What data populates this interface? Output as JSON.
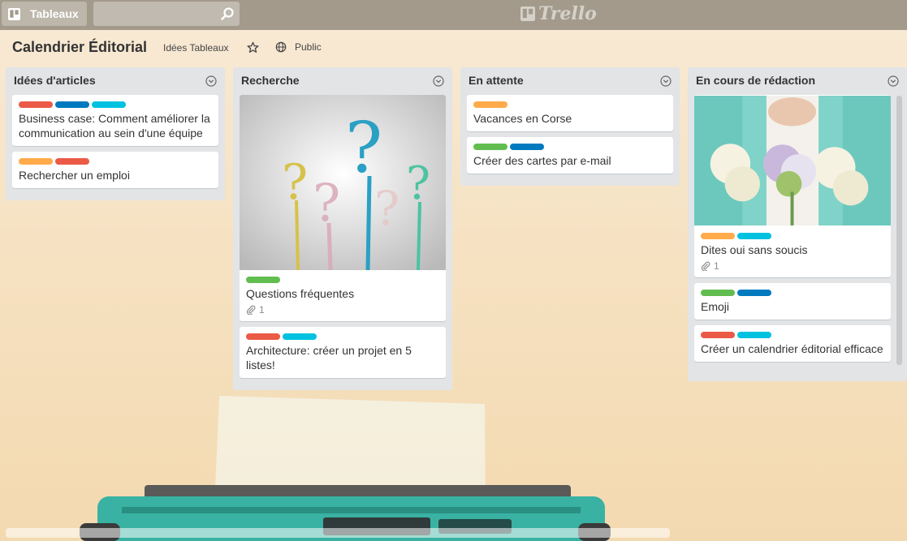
{
  "header": {
    "boards_label": "Tableaux",
    "search_placeholder": "",
    "logo_text": "Trello",
    "brand_color": "#a39a8b"
  },
  "board": {
    "title": "Calendrier Éditorial",
    "team": "Idées Tableaux",
    "visibility": "Public"
  },
  "label_colors": {
    "red": "#eb5a46",
    "blue": "#0079bf",
    "sky": "#00c2e0",
    "orange": "#ffab4a",
    "green": "#61bd4f"
  },
  "lists": [
    {
      "title": "Idées d'articles",
      "cards": [
        {
          "labels": [
            "red",
            "blue",
            "sky"
          ],
          "text": "Business case: Comment améliorer la communication au sein d'une équipe"
        },
        {
          "labels": [
            "orange",
            "red"
          ],
          "text": "Rechercher un emploi"
        }
      ]
    },
    {
      "title": "Recherche",
      "cards": [
        {
          "cover": "question-marks",
          "labels": [
            "green"
          ],
          "text": "Questions fréquentes",
          "attachments": "1"
        },
        {
          "labels": [
            "red",
            "sky"
          ],
          "text": "Architecture: créer un projet en 5 listes!"
        }
      ]
    },
    {
      "title": "En attente",
      "cards": [
        {
          "labels": [
            "orange"
          ],
          "text": "Vacances en Corse"
        },
        {
          "labels": [
            "green",
            "blue"
          ],
          "text": "Créer des cartes par e-mail"
        }
      ]
    },
    {
      "title": "En cours de rédaction",
      "cards": [
        {
          "cover": "bridesmaids-bouquets",
          "labels": [
            "orange",
            "sky"
          ],
          "text": "Dites oui sans soucis",
          "attachments": "1"
        },
        {
          "labels": [
            "green",
            "blue"
          ],
          "text": "Emoji"
        },
        {
          "labels": [
            "red",
            "sky"
          ],
          "text": "Créer un calendrier éditorial efficace"
        }
      ]
    }
  ]
}
